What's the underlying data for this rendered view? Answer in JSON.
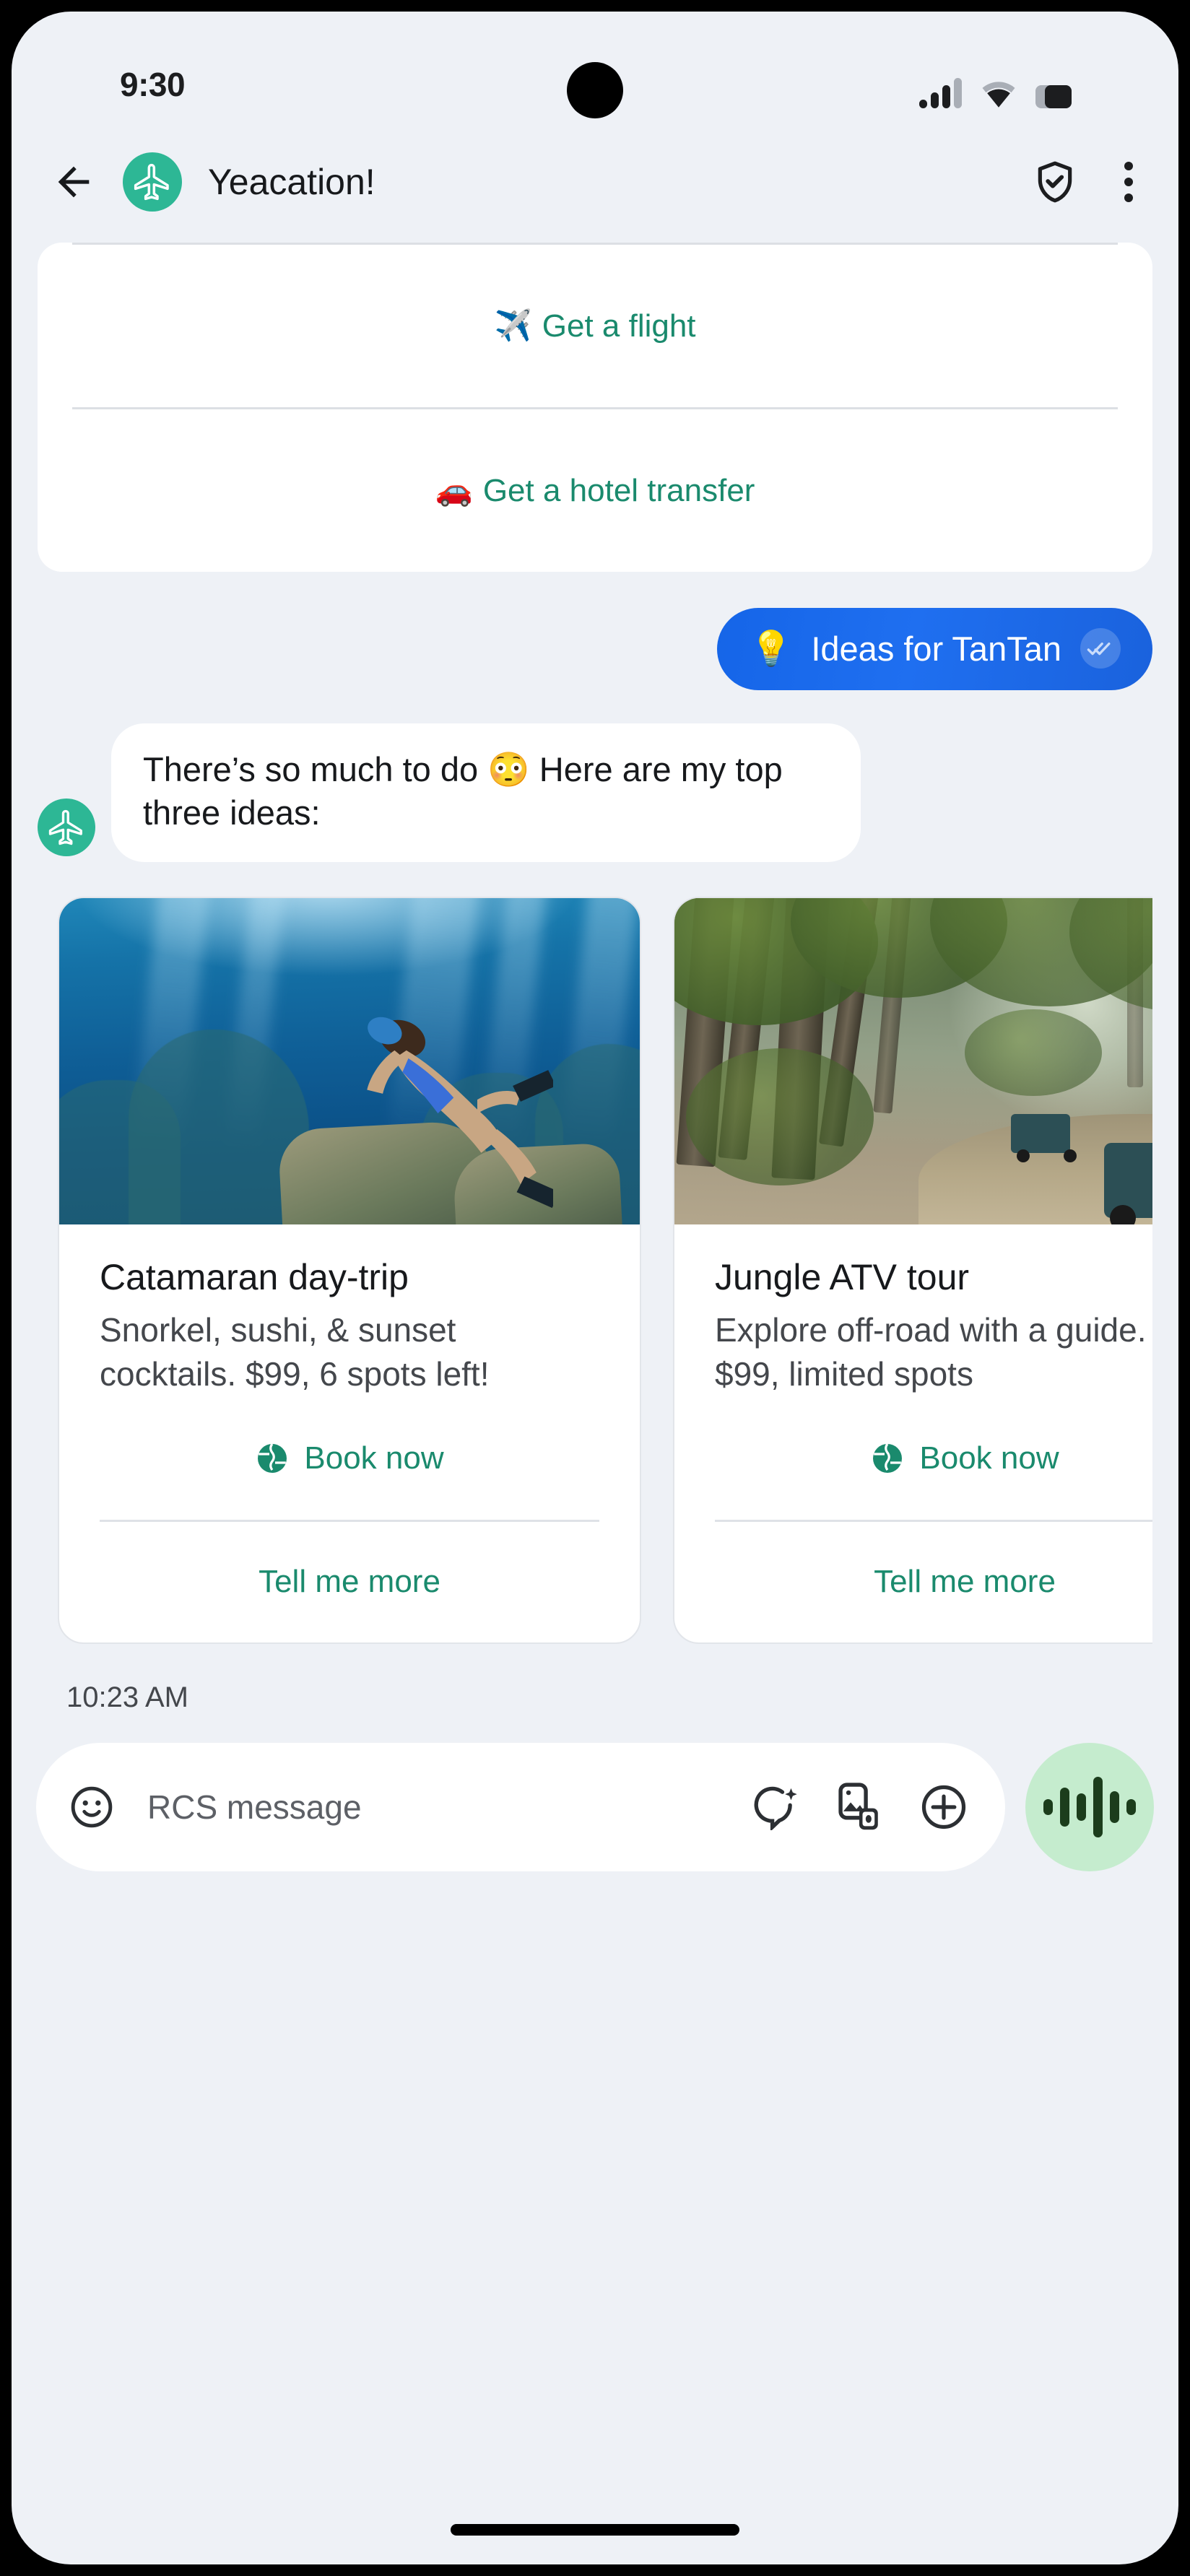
{
  "status_bar": {
    "time": "9:30",
    "signal_icon": "cellular-signal-icon",
    "wifi_icon": "wifi-icon",
    "battery_icon": "battery-icon"
  },
  "app_bar": {
    "back_icon": "back-arrow-icon",
    "avatar_icon": "airplane-avatar-icon",
    "title": "Yeacation!",
    "verified_icon": "shield-check-icon",
    "overflow_icon": "more-vertical-icon"
  },
  "suggestion_card": {
    "actions": [
      {
        "emoji": "✈️",
        "label": "Get a flight",
        "icon": "airplane-icon"
      },
      {
        "emoji": "🚗",
        "label": "Get a hotel transfer",
        "icon": "car-icon"
      }
    ]
  },
  "messages": {
    "outgoing": {
      "emoji": "💡",
      "text": "Ideas for TanTan",
      "read_receipt_icon": "double-check-icon"
    },
    "incoming": {
      "text": "There’s so much to do 😳 Here are my top three ideas:",
      "avatar_icon": "airplane-avatar-icon"
    }
  },
  "carousel": {
    "cards": [
      {
        "image_alt": "underwater-freediver-photo",
        "title": "Catamaran day-trip",
        "description": "Snorkel, sushi, & sunset cocktails. $99, 6 spots left!",
        "primary_action": {
          "label": "Book now",
          "icon": "globe-icon"
        },
        "secondary_action": {
          "label": "Tell me more"
        }
      },
      {
        "image_alt": "jungle-safari-jeeps-photo",
        "title": "Jungle ATV tour",
        "description": "Explore off-road with a guide. $99, limited spots",
        "primary_action": {
          "label": "Book now",
          "icon": "globe-icon"
        },
        "secondary_action": {
          "label": "Tell me more"
        }
      }
    ]
  },
  "timestamp": "10:23 AM",
  "composer": {
    "emoji_icon": "emoji-smiley-icon",
    "placeholder": "RCS message",
    "icons": [
      {
        "name": "magic-compose-icon"
      },
      {
        "name": "gallery-camera-icon"
      },
      {
        "name": "plus-attach-icon"
      }
    ],
    "mic_icon": "voice-waveform-icon"
  },
  "colors": {
    "accent_teal": "#1a8a6d",
    "bubble_blue": "#1f6ff0",
    "avatar_green": "#2db795",
    "screen_bg": "#eef1f6",
    "mic_bg": "#c5ecce"
  }
}
